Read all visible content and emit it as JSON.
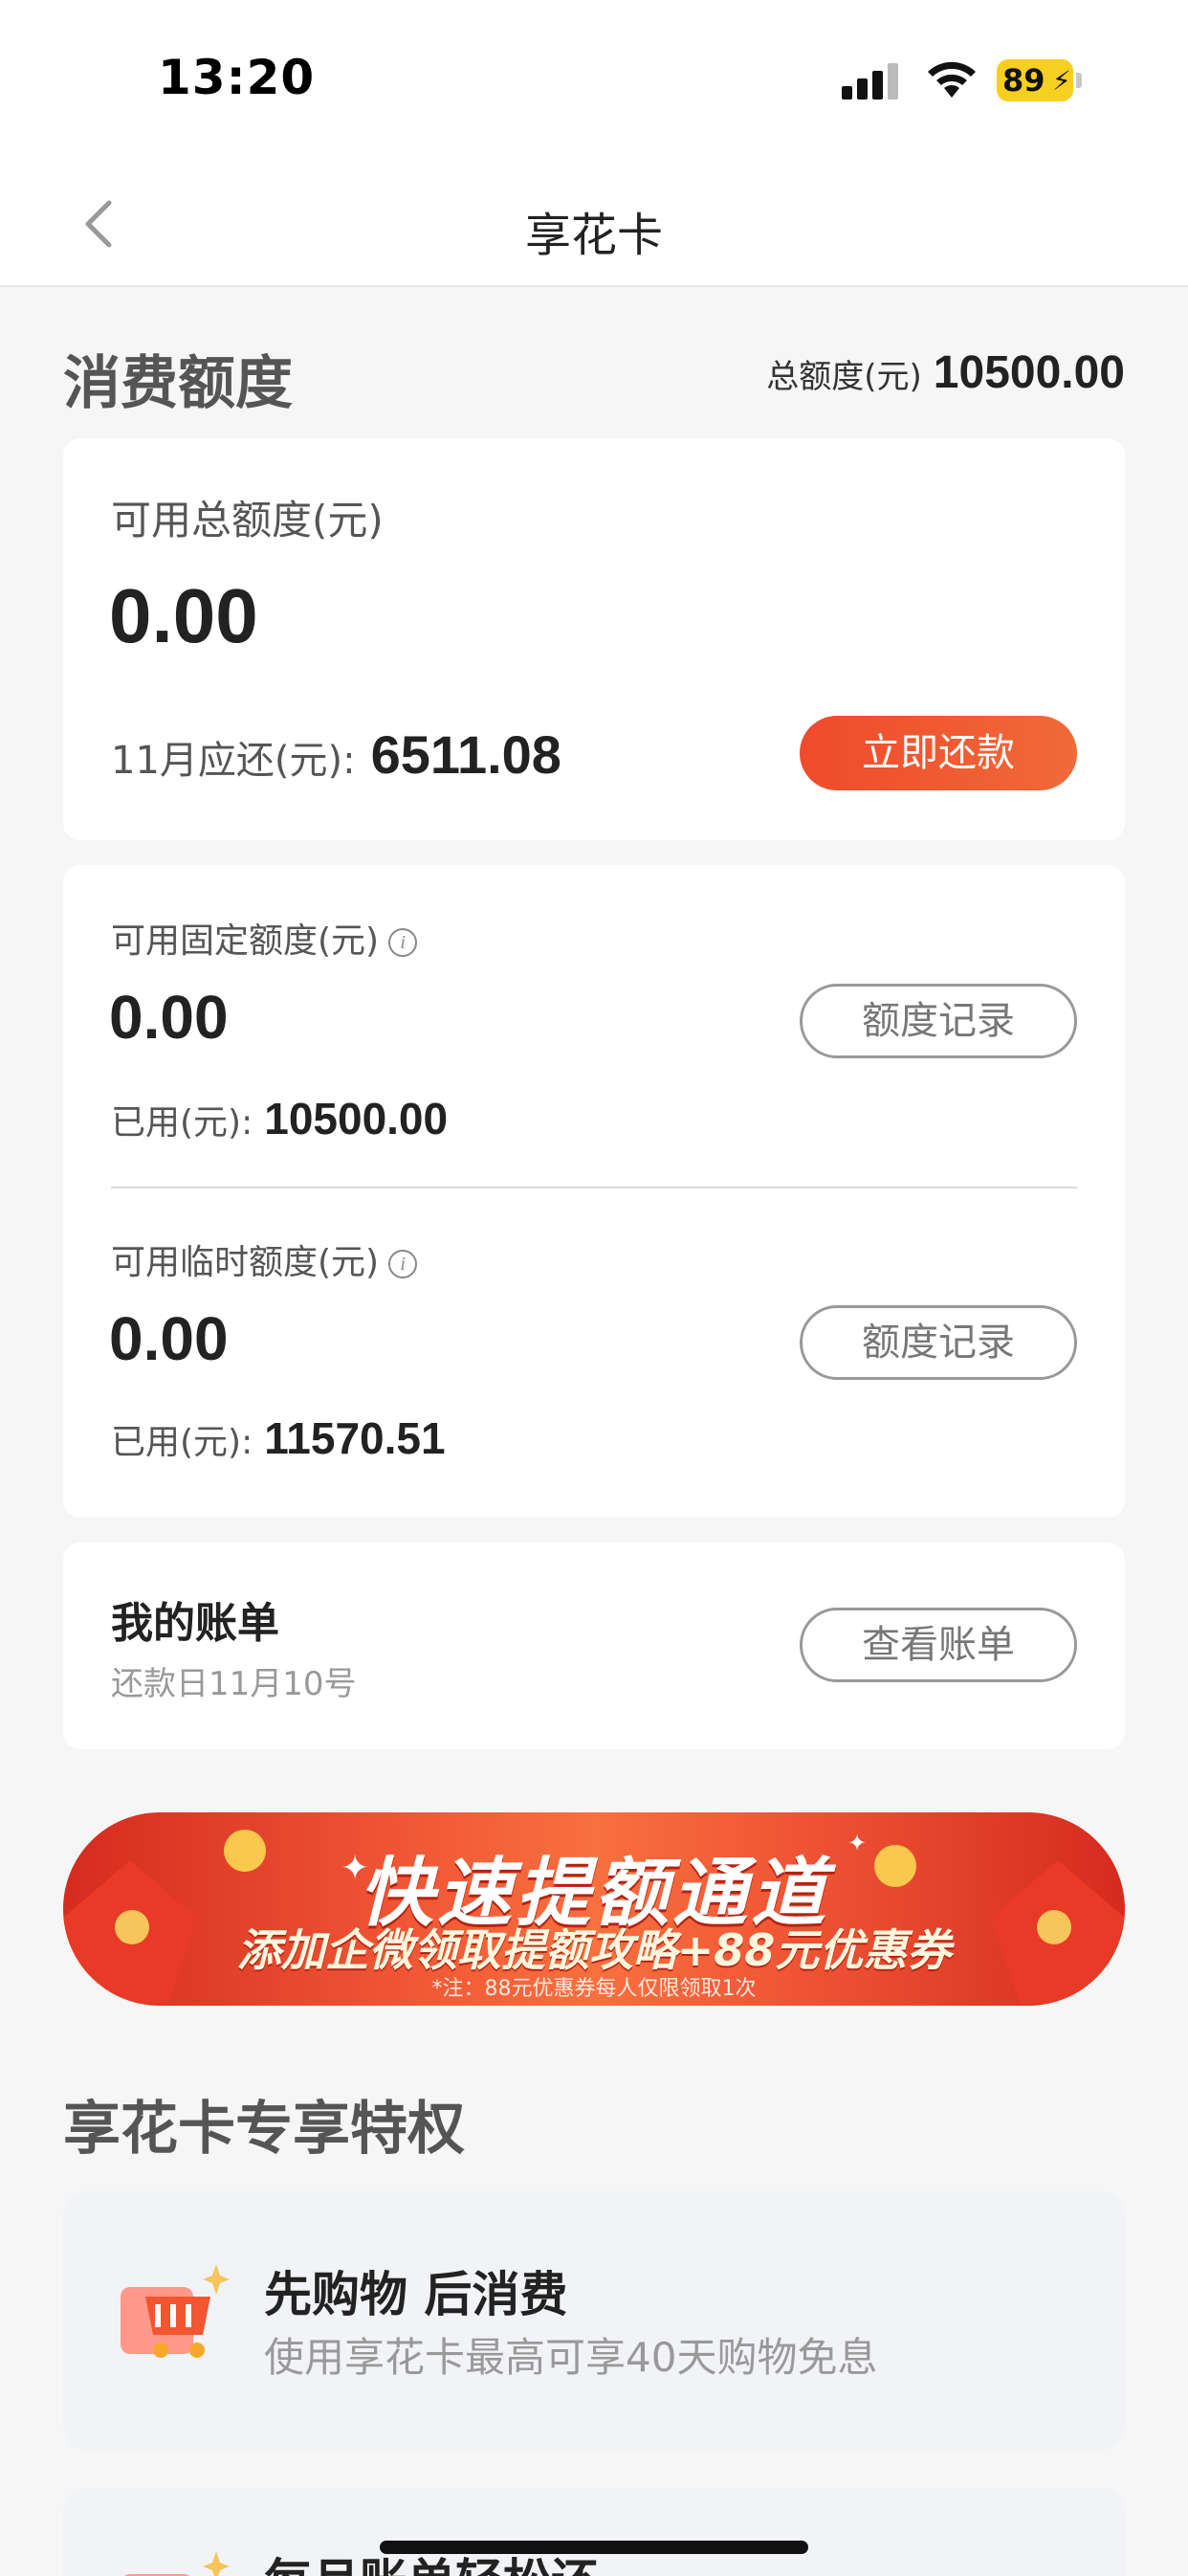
{
  "status": {
    "time": "13:20",
    "battery": "89"
  },
  "nav": {
    "title": "享花卡"
  },
  "quota": {
    "section_title": "消费额度",
    "total_label": "总额度(元)",
    "total_value": "10500.00",
    "available_label": "可用总额度(元)",
    "available_value": "0.00",
    "due_label": "11月应还(元):",
    "due_value": "6511.08",
    "pay_button": "立即还款"
  },
  "fixed": {
    "label": "可用固定额度(元)",
    "value": "0.00",
    "used_label": "已用(元):",
    "used_value": "10500.00",
    "record_button": "额度记录"
  },
  "temp": {
    "label": "可用临时额度(元)",
    "value": "0.00",
    "used_label": "已用(元):",
    "used_value": "11570.51",
    "record_button": "额度记录"
  },
  "bill": {
    "title": "我的账单",
    "sub": "还款日11月10号",
    "button": "查看账单"
  },
  "banner": {
    "title": "快速提额通道",
    "subtitle": "添加企微领取提额攻略+88元优惠券",
    "note": "*注：88元优惠券每人仅限领取1次"
  },
  "privileges": {
    "title": "享花卡专享特权",
    "items": [
      {
        "title": "先购物 后消费",
        "desc": "使用享花卡最高可享40天购物免息"
      },
      {
        "title": "每月账单轻松还",
        "desc": ""
      }
    ]
  },
  "colors": {
    "accent": "#ef4a2c",
    "background": "#f6f6f6"
  }
}
